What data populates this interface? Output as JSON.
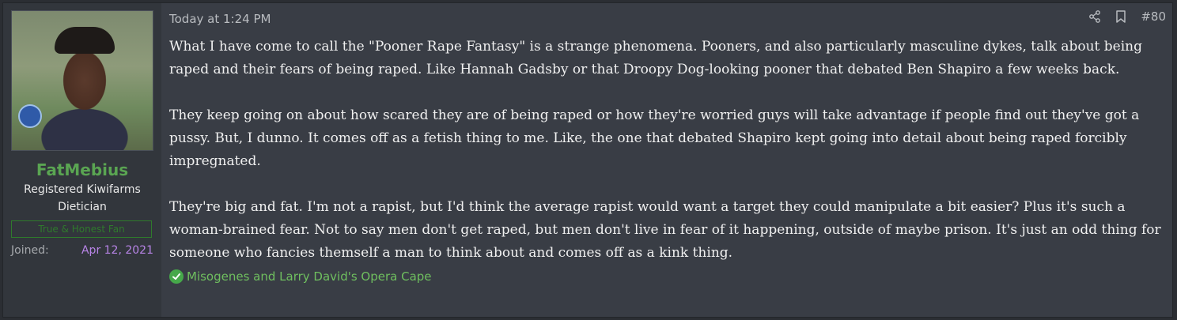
{
  "post": {
    "author": {
      "username": "FatMebius",
      "title": "Registered Kiwifarms Dietician",
      "banner": "True & Honest Fan",
      "joined_label": "Joined:",
      "joined_value": "Apr 12, 2021"
    },
    "timestamp": "Today at 1:24 PM",
    "post_number": "#80",
    "icons": {
      "share": "share-icon",
      "bookmark": "bookmark-icon",
      "reaction": "check-circle-icon"
    },
    "paragraphs": [
      "What I have come to call the \"Pooner Rape Fantasy\" is a strange phenomena. Pooners, and also particularly masculine dykes, talk about being raped and their fears of being raped. Like Hannah Gadsby or that Droopy Dog-looking pooner that debated Ben Shapiro a few weeks back.",
      "They keep going on about how scared they are of being raped or how they're worried guys will take advantage if people find out they've got a pussy. But, I dunno. It comes off as a fetish thing to me. Like, the one that debated Shapiro kept going into detail about being raped forcibly impregnated.",
      "They're big and fat. I'm not a rapist, but I'd think the average rapist would want a target they could manipulate a bit easier? Plus it's such a woman-brained fear. Not to say men don't get raped, but men don't live in fear of it happening, outside of maybe prison. It's just an odd thing for someone who fancies themself a man to think about and comes off as a kink thing."
    ],
    "reactions_text": "Misogenes and Larry David's Opera Cape"
  },
  "colors": {
    "username": "#5aa552",
    "joined_date": "#b784e6",
    "reaction_text": "#6fbf5f",
    "post_bg": "#393d45",
    "sidebar_bg": "#32363c"
  }
}
